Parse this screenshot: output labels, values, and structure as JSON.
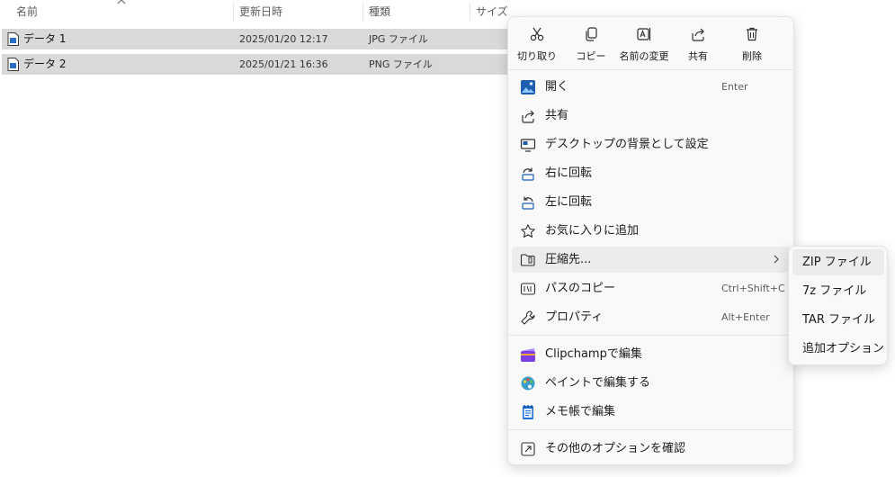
{
  "columns": {
    "name": "名前",
    "modified": "更新日時",
    "type": "種類",
    "size": "サイズ"
  },
  "files": [
    {
      "name": "データ 1",
      "modified": "2025/01/20 12:17",
      "type": "JPG ファイル"
    },
    {
      "name": "データ 2",
      "modified": "2025/01/21 16:36",
      "type": "PNG ファイル"
    }
  ],
  "context_menu": {
    "quick_actions": [
      {
        "label": "切り取り",
        "icon": "scissors-icon"
      },
      {
        "label": "コピー",
        "icon": "copy-icon"
      },
      {
        "label": "名前の変更",
        "icon": "rename-icon"
      },
      {
        "label": "共有",
        "icon": "share-icon"
      },
      {
        "label": "削除",
        "icon": "trash-icon"
      }
    ],
    "items": [
      {
        "label": "開く",
        "shortcut": "Enter",
        "icon": "photos-app-icon"
      },
      {
        "label": "共有",
        "shortcut": "",
        "icon": "share-icon"
      },
      {
        "label": "デスクトップの背景として設定",
        "shortcut": "",
        "icon": "wallpaper-icon"
      },
      {
        "label": "右に回転",
        "shortcut": "",
        "icon": "rotate-right-icon"
      },
      {
        "label": "左に回転",
        "shortcut": "",
        "icon": "rotate-left-icon"
      },
      {
        "label": "お気に入りに追加",
        "shortcut": "",
        "icon": "star-icon"
      },
      {
        "label": "圧縮先...",
        "shortcut": "",
        "icon": "zip-folder-icon"
      },
      {
        "label": "パスのコピー",
        "shortcut": "Ctrl+Shift+C",
        "icon": "copy-path-icon"
      },
      {
        "label": "プロパティ",
        "shortcut": "Alt+Enter",
        "icon": "wrench-icon"
      },
      {
        "label": "Clipchampで編集",
        "shortcut": "",
        "icon": "clipchamp-icon"
      },
      {
        "label": "ペイントで編集する",
        "shortcut": "",
        "icon": "paint-icon"
      },
      {
        "label": "メモ帳で編集",
        "shortcut": "",
        "icon": "notepad-icon"
      },
      {
        "label": "その他のオプションを確認",
        "shortcut": "",
        "icon": "more-options-icon"
      }
    ]
  },
  "compress_submenu": {
    "items": [
      "ZIP ファイル",
      "7z ファイル",
      "TAR ファイル",
      "追加オプション"
    ]
  },
  "colors": {
    "selection": "#d9d9d9",
    "menu_bg": "#f9f9f9",
    "hover": "#ececec",
    "accent": "#0067c0"
  }
}
